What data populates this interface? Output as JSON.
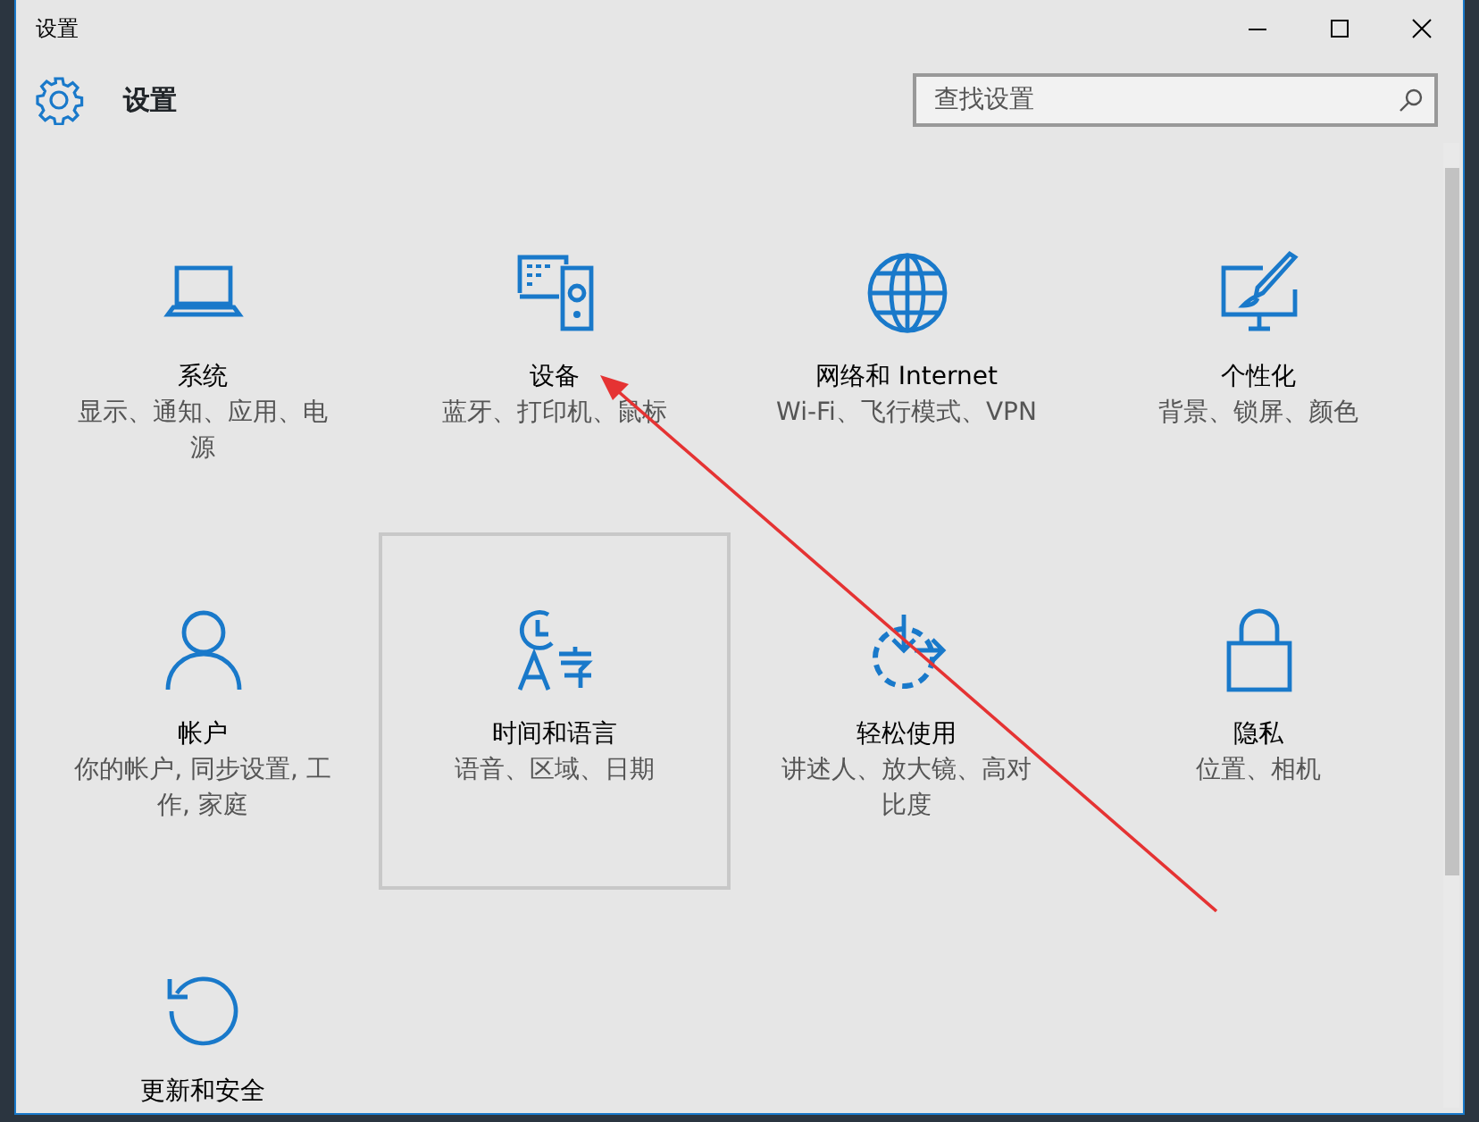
{
  "window": {
    "title": "设置"
  },
  "header": {
    "title": "设置",
    "search": {
      "placeholder": "查找设置"
    }
  },
  "tiles": [
    {
      "kind": "laptop",
      "title": "系统",
      "description": "显示、通知、应用、电源",
      "selected": false
    },
    {
      "kind": "devices",
      "title": "设备",
      "description": "蓝牙、打印机、鼠标",
      "selected": false
    },
    {
      "kind": "globe",
      "title": "网络和 Internet",
      "description": "Wi-Fi、飞行模式、VPN",
      "selected": false
    },
    {
      "kind": "paint",
      "title": "个性化",
      "description": "背景、锁屏、颜色",
      "selected": false
    },
    {
      "kind": "person",
      "title": "帐户",
      "description": "你的帐户, 同步设置, 工作, 家庭",
      "selected": false
    },
    {
      "kind": "timelang",
      "title": "时间和语言",
      "description": "语音、区域、日期",
      "selected": true
    },
    {
      "kind": "ease",
      "title": "轻松使用",
      "description": "讲述人、放大镜、高对比度",
      "selected": false
    },
    {
      "kind": "lock",
      "title": "隐私",
      "description": "位置、相机",
      "selected": false
    },
    {
      "kind": "update",
      "title": "更新和安全",
      "selected": false
    }
  ]
}
